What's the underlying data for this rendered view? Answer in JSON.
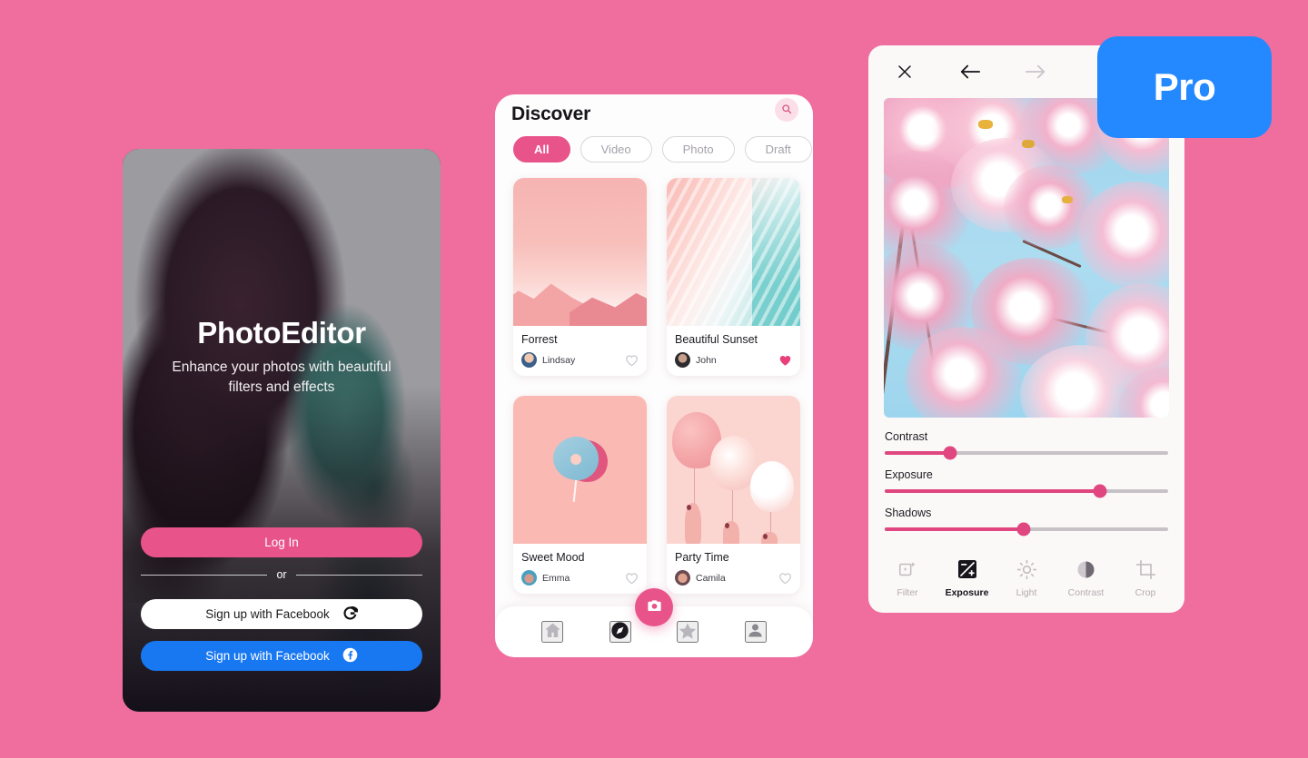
{
  "theme": {
    "background": "#ef6e9e",
    "accent_pink": "#e8538a",
    "slider_pink": "#e0467f",
    "facebook_blue": "#1778f2",
    "pro_blue": "#2489ff"
  },
  "login": {
    "title": "PhotoEditor",
    "subtitle": "Enhance your photos with beautiful filters and effects",
    "login_button": "Log In",
    "divider": "or",
    "google_button": "Sign up with Facebook",
    "google_icon": "google-icon",
    "facebook_button": "Sign up with Facebook",
    "facebook_icon": "facebook-icon",
    "photo_alt": "woman-profile-duotone-photo"
  },
  "discover": {
    "title": "Discover",
    "search_icon": "search-icon",
    "chips": [
      {
        "label": "All",
        "active": true
      },
      {
        "label": "Video",
        "active": false
      },
      {
        "label": "Photo",
        "active": false
      },
      {
        "label": "Draft",
        "active": false
      }
    ],
    "cards": [
      {
        "title": "Forrest",
        "author": "Lindsay",
        "liked": false,
        "art": "pink-mountain-landscape"
      },
      {
        "title": "Beautiful Sunset",
        "author": "John",
        "liked": true,
        "art": "pink-teal-abstract-sunset"
      },
      {
        "title": "Sweet Mood",
        "author": "Emma",
        "liked": false,
        "art": "blue-pink-lollipop"
      },
      {
        "title": "Party Time",
        "author": "Camila",
        "liked": false,
        "art": "pink-balloons"
      }
    ],
    "nav": [
      {
        "icon": "home-icon",
        "label": "Home",
        "active": false
      },
      {
        "icon": "compass-icon",
        "label": "Explore",
        "active": true
      },
      {
        "icon": "star-icon",
        "label": "Starred",
        "active": false
      },
      {
        "icon": "person-icon",
        "label": "Profile",
        "active": false
      }
    ],
    "fab_icon": "camera-icon"
  },
  "editor": {
    "topbar": [
      {
        "icon": "close-icon",
        "state": "enabled"
      },
      {
        "icon": "back-arrow-icon",
        "state": "enabled"
      },
      {
        "icon": "forward-arrow-icon",
        "state": "disabled"
      },
      {
        "icon": "image-icon",
        "state": "enabled"
      }
    ],
    "photo_alt": "cherry-blossom-photo",
    "sliders": [
      {
        "label": "Contrast",
        "value": 23
      },
      {
        "label": "Exposure",
        "value": 76
      },
      {
        "label": "Shadows",
        "value": 49
      }
    ],
    "tools": [
      {
        "label": "Filter",
        "icon": "filter-icon",
        "active": false
      },
      {
        "label": "Exposure",
        "icon": "exposure-icon",
        "active": true
      },
      {
        "label": "Light",
        "icon": "light-icon",
        "active": false
      },
      {
        "label": "Contrast",
        "icon": "contrast-icon",
        "active": false
      },
      {
        "label": "Crop",
        "icon": "crop-icon",
        "active": false
      }
    ]
  },
  "pro_badge": {
    "label": "Pro"
  }
}
